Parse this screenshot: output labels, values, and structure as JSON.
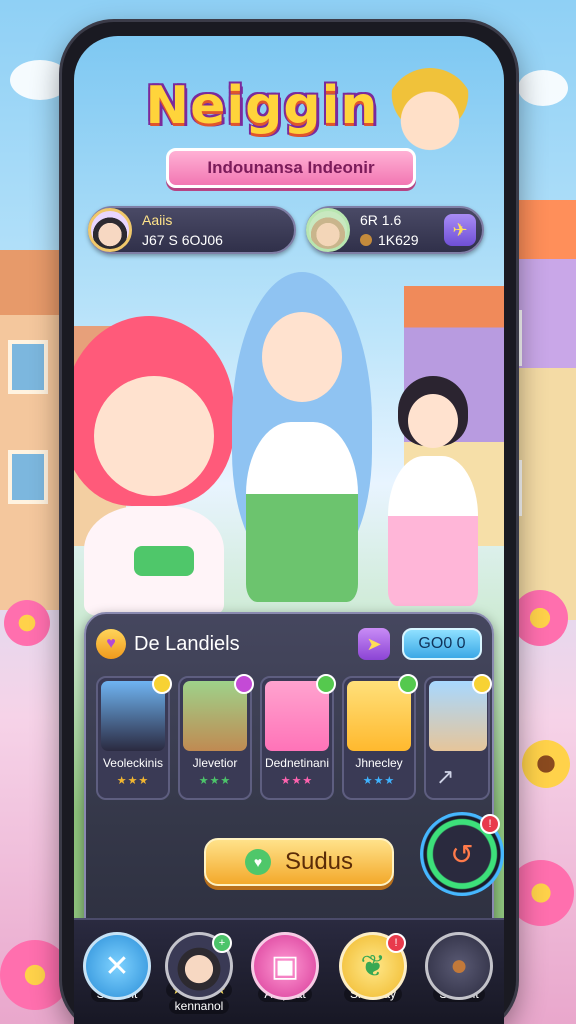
{
  "game": {
    "logo": "Neiggin",
    "subtitle": "Indounansa Indeonir"
  },
  "players": [
    {
      "name": "Aaiis",
      "value": "J67 S 6OJ06",
      "avatar": "boy-avatar"
    },
    {
      "name": "6R 1.6",
      "value": "1K629",
      "avatar": "elder-avatar"
    }
  ],
  "team": {
    "title": "De Landiels",
    "gold": "GO0 0",
    "cards": [
      {
        "name": "Veoleckinis",
        "stars": "★★★",
        "color": "#f2b630",
        "badge": "#f7d233"
      },
      {
        "name": "Jlevetior",
        "stars": "★★★",
        "color": "#4cc46a",
        "badge": "#c44ad6"
      },
      {
        "name": "Dednetinani",
        "stars": "★★★",
        "color": "#ff63b0",
        "badge": "#55c94e"
      },
      {
        "name": "Jhnecley",
        "stars": "★★★",
        "color": "#3fb3ff",
        "badge": "#55c94e"
      },
      {
        "name": "",
        "stars": "",
        "color": "#f2b630",
        "badge": "#f7d233"
      }
    ],
    "action_label": "Sudus",
    "ring_badge": "!"
  },
  "nav": [
    {
      "label": "Srallont",
      "icon": "cross-icon",
      "bg": "#3aa8ee"
    },
    {
      "label": "kennanol",
      "icon": "boy-icon",
      "bg": "#2f2f46",
      "stars": "★★★★★",
      "badge": "#4cc46a"
    },
    {
      "label": "Aatpoat",
      "icon": "calendar-icon",
      "bg": "#f061b5"
    },
    {
      "label": "Slaneiay",
      "icon": "leaf-icon",
      "bg": "#f7d23c",
      "badge": "#e83a4c"
    },
    {
      "label": "SBnant",
      "icon": "burger-icon",
      "bg": "#3b3b52"
    }
  ]
}
